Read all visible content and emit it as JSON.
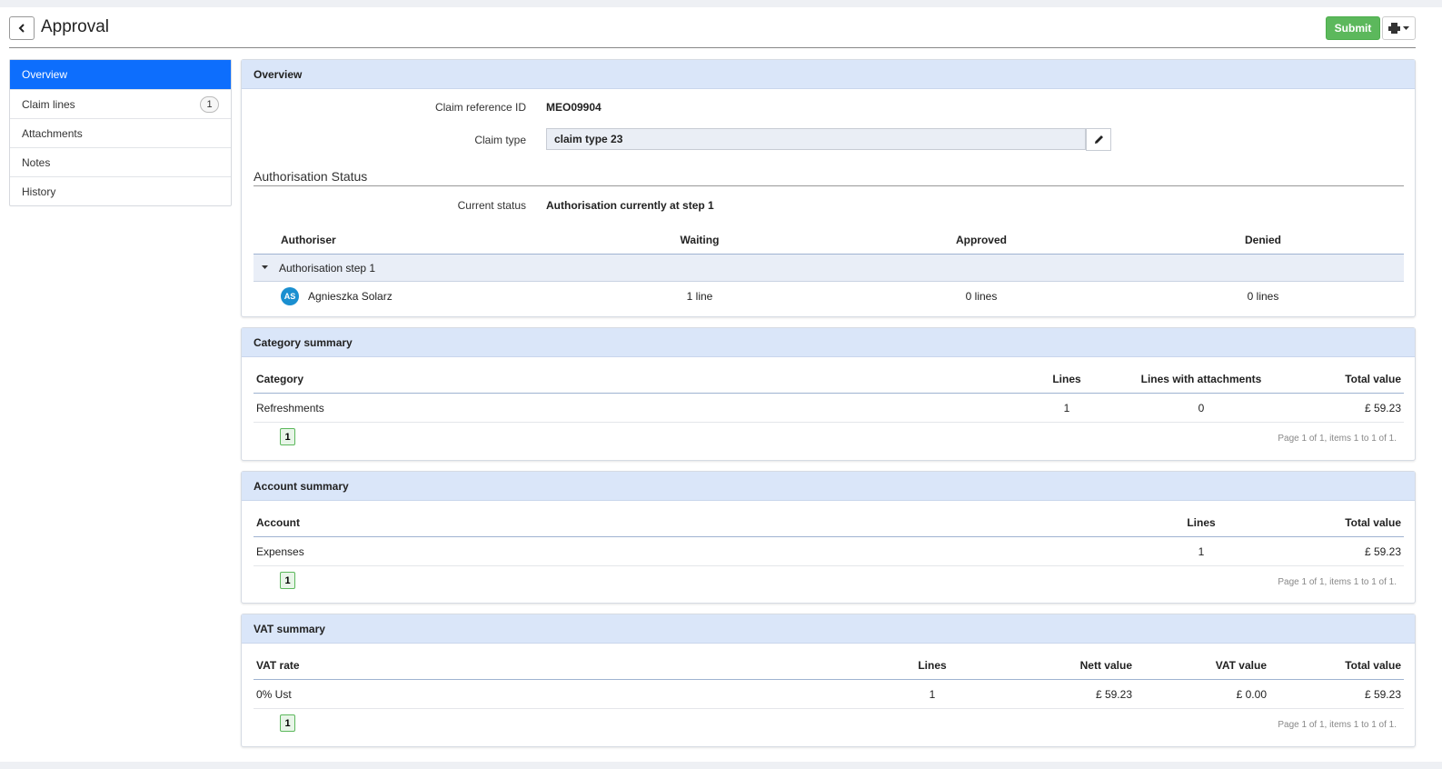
{
  "header": {
    "title": "Approval",
    "submit_label": "Submit"
  },
  "sidebar": {
    "items": [
      {
        "label": "Overview",
        "active": true
      },
      {
        "label": "Claim lines",
        "badge": "1"
      },
      {
        "label": "Attachments"
      },
      {
        "label": "Notes"
      },
      {
        "label": "History"
      }
    ]
  },
  "overview": {
    "title": "Overview",
    "claim_ref_label": "Claim reference ID",
    "claim_ref_value": "MEO09904",
    "claim_type_label": "Claim type",
    "claim_type_value": "claim type 23",
    "auth_title": "Authorisation Status",
    "current_status_label": "Current status",
    "current_status_value": "Authorisation currently at step 1",
    "columns": {
      "authoriser": "Authoriser",
      "waiting": "Waiting",
      "approved": "Approved",
      "denied": "Denied"
    },
    "step_label": "Authorisation step 1",
    "row": {
      "initials": "AS",
      "name": "Agnieszka Solarz",
      "waiting": "1 line",
      "approved": "0 lines",
      "denied": "0 lines"
    }
  },
  "category_summary": {
    "title": "Category summary",
    "columns": {
      "category": "Category",
      "lines": "Lines",
      "attachments": "Lines with attachments",
      "total": "Total value"
    },
    "row": {
      "category": "Refreshments",
      "lines": "1",
      "attachments": "0",
      "total": "£ 59.23"
    },
    "page": "1",
    "page_info": "Page 1 of 1, items 1 to 1 of 1."
  },
  "account_summary": {
    "title": "Account summary",
    "columns": {
      "account": "Account",
      "lines": "Lines",
      "total": "Total value"
    },
    "row": {
      "account": "Expenses",
      "lines": "1",
      "total": "£ 59.23"
    },
    "page": "1",
    "page_info": "Page 1 of 1, items 1 to 1 of 1."
  },
  "vat_summary": {
    "title": "VAT summary",
    "columns": {
      "rate": "VAT rate",
      "lines": "Lines",
      "nett": "Nett value",
      "vat": "VAT value",
      "total": "Total value"
    },
    "row": {
      "rate": "0% Ust",
      "lines": "1",
      "nett": "£ 59.23",
      "vat": "£ 0.00",
      "total": "£ 59.23"
    },
    "page": "1",
    "page_info": "Page 1 of 1, items 1 to 1 of 1."
  },
  "colors": {
    "primary": "#0d6efd",
    "success": "#5cb85c",
    "panel_header": "#dae6f9"
  },
  "icons": {
    "back": "chevron-left-icon",
    "edit": "pencil-icon",
    "menu": "print-icon",
    "step_toggle": "caret-down-icon"
  }
}
